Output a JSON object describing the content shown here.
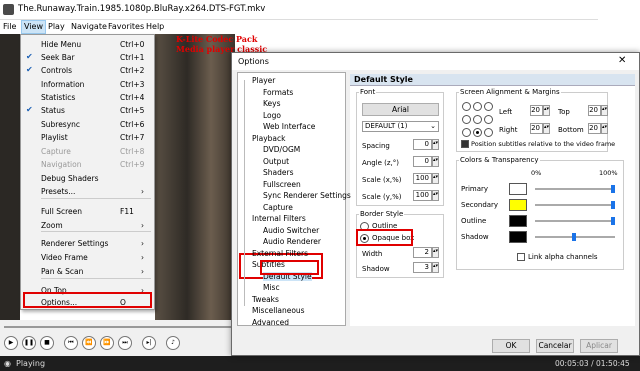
{
  "window": {
    "title": "The.Runaway.Train.1985.1080p.BluRay.x264.DTS-FGT.mkv"
  },
  "menubar": [
    "File",
    "View",
    "Play",
    "Navigate",
    "Favorites",
    "Help"
  ],
  "overlay": {
    "line1": "K-Lite Codec Pack",
    "line2": "Media player classic"
  },
  "view_menu": [
    {
      "label": "Hide Menu",
      "key": "Ctrl+0",
      "check": false,
      "disabled": false
    },
    {
      "label": "Seek Bar",
      "key": "Ctrl+1",
      "check": true,
      "disabled": false
    },
    {
      "label": "Controls",
      "key": "Ctrl+2",
      "check": true,
      "disabled": false
    },
    {
      "label": "Information",
      "key": "Ctrl+3",
      "check": false,
      "disabled": false
    },
    {
      "label": "Statistics",
      "key": "Ctrl+4",
      "check": false,
      "disabled": false
    },
    {
      "label": "Status",
      "key": "Ctrl+5",
      "check": true,
      "disabled": false
    },
    {
      "label": "Subresync",
      "key": "Ctrl+6",
      "check": false,
      "disabled": false
    },
    {
      "label": "Playlist",
      "key": "Ctrl+7",
      "check": false,
      "disabled": false
    },
    {
      "label": "Capture",
      "key": "Ctrl+8",
      "check": false,
      "disabled": true
    },
    {
      "label": "Navigation",
      "key": "Ctrl+9",
      "check": false,
      "disabled": true
    },
    {
      "label": "Debug Shaders",
      "key": "",
      "check": false,
      "disabled": false
    },
    {
      "label": "Presets...",
      "key": "",
      "check": false,
      "disabled": false,
      "submenu": true
    },
    {
      "label": "Full Screen",
      "key": "F11",
      "check": false,
      "disabled": false
    },
    {
      "label": "Zoom",
      "key": "",
      "check": false,
      "disabled": false,
      "submenu": true
    },
    {
      "label": "Renderer Settings",
      "key": "",
      "check": false,
      "disabled": false,
      "submenu": true
    },
    {
      "label": "Video Frame",
      "key": "",
      "check": false,
      "disabled": false,
      "submenu": true
    },
    {
      "label": "Pan & Scan",
      "key": "",
      "check": false,
      "disabled": false,
      "submenu": true
    },
    {
      "label": "On Top",
      "key": "",
      "check": false,
      "disabled": false,
      "submenu": true
    },
    {
      "label": "Options...",
      "key": "O",
      "check": false,
      "disabled": false
    }
  ],
  "status": {
    "text": "Playing",
    "time": "00:05:03 / 01:50:45"
  },
  "dialog": {
    "title": "Options",
    "tree": [
      {
        "label": "Player",
        "level": 0
      },
      {
        "label": "Formats",
        "level": 1
      },
      {
        "label": "Keys",
        "level": 1
      },
      {
        "label": "Logo",
        "level": 1
      },
      {
        "label": "Web Interface",
        "level": 1
      },
      {
        "label": "Playback",
        "level": 0
      },
      {
        "label": "DVD/OGM",
        "level": 1
      },
      {
        "label": "Output",
        "level": 1
      },
      {
        "label": "Shaders",
        "level": 1
      },
      {
        "label": "Fullscreen",
        "level": 1
      },
      {
        "label": "Sync Renderer Settings",
        "level": 1
      },
      {
        "label": "Capture",
        "level": 1
      },
      {
        "label": "Internal Filters",
        "level": 0
      },
      {
        "label": "Audio Switcher",
        "level": 1
      },
      {
        "label": "Audio Renderer",
        "level": 1
      },
      {
        "label": "External Filters",
        "level": 0
      },
      {
        "label": "Subtitles",
        "level": 0
      },
      {
        "label": "Default Style",
        "level": 1
      },
      {
        "label": "Misc",
        "level": 1
      },
      {
        "label": "Tweaks",
        "level": 0
      },
      {
        "label": "Miscellaneous",
        "level": 0
      },
      {
        "label": "Advanced",
        "level": 0
      }
    ],
    "panel_title": "Default Style",
    "font": {
      "group": "Font",
      "button": "Arial",
      "charset": "DEFAULT (1)",
      "spacing_label": "Spacing",
      "spacing": "0",
      "angle_label": "Angle (z,°)",
      "angle": "0",
      "scalex_label": "Scale (x,%)",
      "scalex": "100",
      "scaley_label": "Scale (y,%)",
      "scaley": "100"
    },
    "border": {
      "group": "Border Style",
      "outline": "Outline",
      "opaque": "Opaque box",
      "width_label": "Width",
      "width": "2",
      "shadow_label": "Shadow",
      "shadow": "3"
    },
    "align": {
      "group": "Screen Alignment & Margins",
      "left_label": "Left",
      "left": "20",
      "top_label": "Top",
      "top": "20",
      "right_label": "Right",
      "right": "20",
      "bottom_label": "Bottom",
      "bottom": "20",
      "relative": "Position subtitles relative to the video frame"
    },
    "colors": {
      "group": "Colors & Transparency",
      "pct0": "0%",
      "pct100": "100%",
      "rows": [
        {
          "label": "Primary",
          "color": "#ffffff",
          "level": 1.0
        },
        {
          "label": "Secondary",
          "color": "#ffff00",
          "level": 1.0
        },
        {
          "label": "Outline",
          "color": "#000000",
          "level": 1.0
        },
        {
          "label": "Shadow",
          "color": "#000000",
          "level": 0.5
        }
      ],
      "link": "Link alpha channels"
    },
    "buttons": {
      "ok": "OK",
      "cancel": "Cancelar",
      "apply": "Aplicar"
    }
  }
}
